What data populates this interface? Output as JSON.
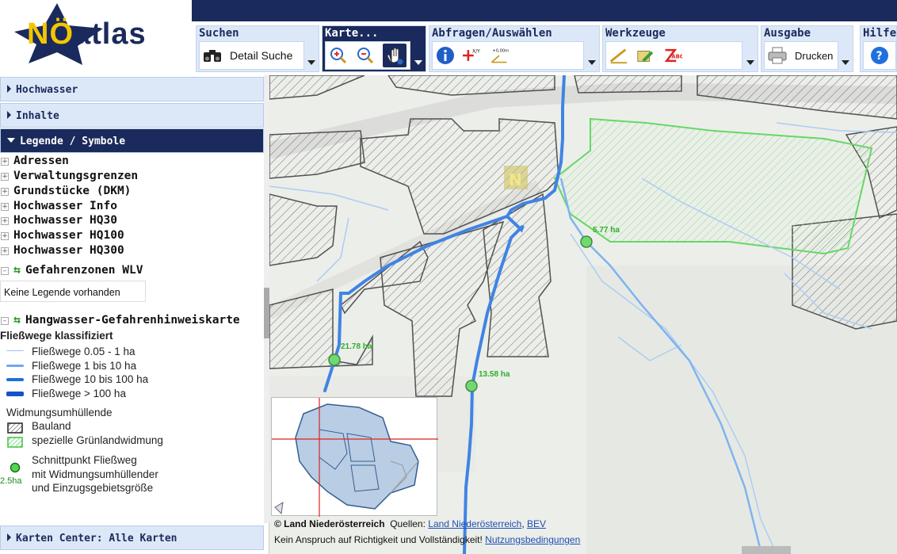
{
  "logo": {
    "text": "NÖatlas",
    "alt": "NÖatlas logo"
  },
  "toolbar": {
    "suchen": {
      "title": "Suchen",
      "button": "Detail Suche"
    },
    "karte": {
      "title": "Karte..."
    },
    "abfragen": {
      "title": "Abfragen/Auswählen"
    },
    "werkzeuge": {
      "title": "Werkzeuge"
    },
    "ausgabe": {
      "title": "Ausgabe",
      "button": "Drucken"
    },
    "hilfe": {
      "title": "Hilfe"
    }
  },
  "sidebar": {
    "panels": [
      {
        "label": "Hochwasser"
      },
      {
        "label": "Inhalte"
      },
      {
        "label": "Legende / Symbole"
      }
    ],
    "tree": [
      {
        "label": "Adressen"
      },
      {
        "label": "Verwaltungsgrenzen"
      },
      {
        "label": "Grundstücke (DKM)"
      },
      {
        "label": "Hochwasser Info"
      },
      {
        "label": "Hochwasser HQ30"
      },
      {
        "label": "Hochwasser HQ100"
      },
      {
        "label": "Hochwasser HQ300"
      }
    ],
    "gefahrenzonen": "Gefahrenzonen WLV",
    "no_legend": "Keine Legende vorhanden",
    "hangwasser": "Hangwasser-Gefahrenhinweiskarte",
    "bottom_panel": "Karten Center: Alle Karten"
  },
  "legend": {
    "title": "Fließwege klassifiziert",
    "lines": [
      "Fließwege 0.05 - 1 ha",
      "Fließwege 1 bis 10 ha",
      "Fließwege 10 bis 100 ha",
      "Fließwege > 100 ha"
    ],
    "widmung_title": "Widmungsumhüllende",
    "bauland": "Bauland",
    "gruenland": "spezielle Grünlandwidmung",
    "schnitt1": "Schnittpunkt Fließweg",
    "schnitt2": "mit Widmungsumhüllender",
    "schnitt3": "und Einzugsgebietsgröße",
    "schnitt_val": "2.5ha"
  },
  "map": {
    "labels": [
      "5.77 ha",
      "21.78 ha",
      "13.58 ha"
    ],
    "attribution": {
      "copyright": "© Land Niederösterreich",
      "sources_label": "Quellen:",
      "link1": "Land Niederösterreich",
      "link2": "BEV",
      "disclaimer": "Kein Anspruch auf Richtigkeit und Vollständigkeit!",
      "terms": "Nutzungsbedingungen"
    }
  },
  "colors": {
    "navy": "#1b2a5c",
    "panel": "#dce8f8",
    "flow": "#1f6fe0",
    "green": "#3dc43d"
  }
}
